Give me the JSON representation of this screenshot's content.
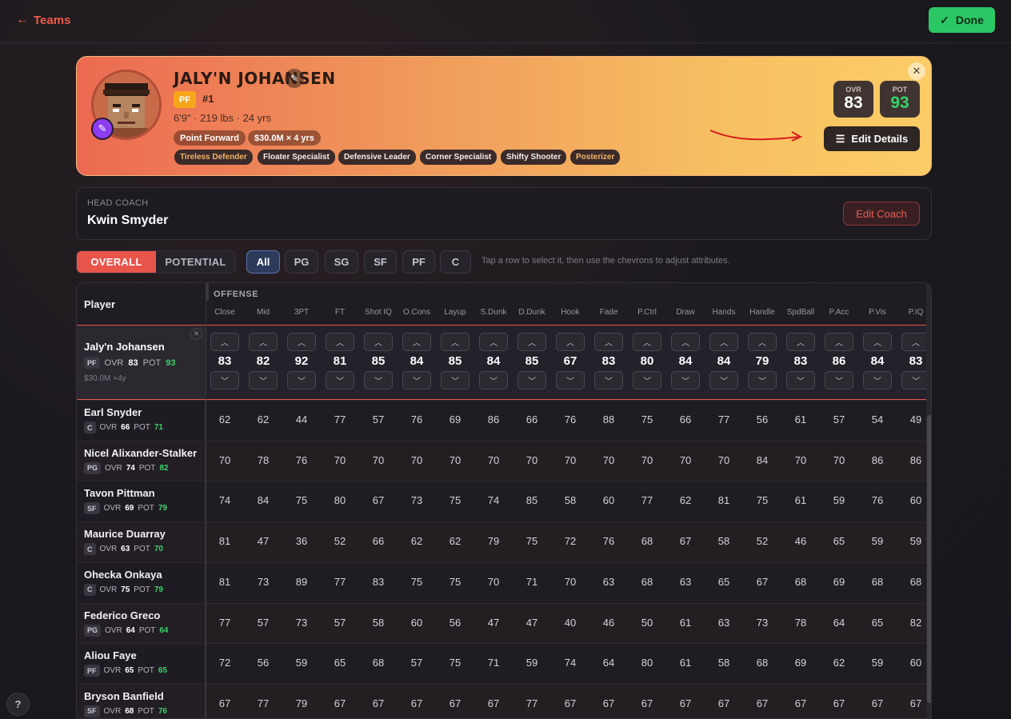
{
  "nav": {
    "back_label": "Teams",
    "done_label": "Done"
  },
  "player": {
    "name": "JALY'N JOHANSEN",
    "position": "PF",
    "jersey": "#1",
    "measurements": "6'9\" · 219 lbs · 24 yrs",
    "role": "Point Forward",
    "contract": "$30.0M × 4 yrs",
    "traits": [
      {
        "label": "Tireless Defender",
        "gold": true
      },
      {
        "label": "Floater Specialist",
        "gold": false
      },
      {
        "label": "Defensive Leader",
        "gold": false
      },
      {
        "label": "Corner Specialist",
        "gold": false
      },
      {
        "label": "Shifty Shooter",
        "gold": false
      },
      {
        "label": "Posterizer",
        "gold": true
      }
    ],
    "ovr_label": "OVR",
    "ovr": "83",
    "pot_label": "POT",
    "pot": "93",
    "edit_details_label": "Edit Details"
  },
  "coach": {
    "label": "HEAD COACH",
    "name": "Kwin Smyder",
    "edit_label": "Edit Coach"
  },
  "filters": {
    "modes": [
      "OVERALL",
      "POTENTIAL"
    ],
    "active_mode": "OVERALL",
    "positions": [
      "All",
      "PG",
      "SG",
      "SF",
      "PF",
      "C"
    ],
    "active_position": "All",
    "hint": "Tap a row to select it, then use the chevrons to adjust attributes."
  },
  "table": {
    "player_header": "Player",
    "group_label": "OFFENSE",
    "columns": [
      "Close",
      "Mid",
      "3PT",
      "FT",
      "Shot IQ",
      "O.Cons",
      "Layup",
      "S.Dunk",
      "D.Dunk",
      "Hook",
      "Fade",
      "P.Ctrl",
      "Draw",
      "Hands",
      "Handle",
      "SpdBall",
      "P.Acc",
      "P.Vis",
      "P.IQ"
    ],
    "selected": {
      "name": "Jaly'n Johansen",
      "pos": "PF",
      "ovr_label": "OVR",
      "ovr": "83",
      "pot_label": "POT",
      "pot": "93",
      "money": "$30.0M ×4y",
      "values": [
        83,
        82,
        92,
        81,
        85,
        84,
        85,
        84,
        85,
        67,
        83,
        80,
        84,
        84,
        79,
        83,
        86,
        84,
        83
      ]
    },
    "rows": [
      {
        "name": "Earl Snyder",
        "pos": "C",
        "ovr": "66",
        "pot": "71",
        "values": [
          62,
          62,
          44,
          77,
          57,
          76,
          69,
          86,
          66,
          76,
          88,
          75,
          66,
          77,
          56,
          61,
          57,
          54,
          49
        ]
      },
      {
        "name": "Nicel Alixander-Stalker",
        "pos": "PG",
        "ovr": "74",
        "pot": "82",
        "values": [
          70,
          78,
          76,
          70,
          70,
          70,
          70,
          70,
          70,
          70,
          70,
          70,
          70,
          70,
          84,
          70,
          70,
          86,
          86
        ]
      },
      {
        "name": "Tavon Pittman",
        "pos": "SF",
        "ovr": "69",
        "pot": "79",
        "values": [
          74,
          84,
          75,
          80,
          67,
          73,
          75,
          74,
          85,
          58,
          60,
          77,
          62,
          81,
          75,
          61,
          59,
          76,
          60
        ]
      },
      {
        "name": "Maurice Duarray",
        "pos": "C",
        "ovr": "63",
        "pot": "70",
        "values": [
          81,
          47,
          36,
          52,
          66,
          62,
          62,
          79,
          75,
          72,
          76,
          68,
          67,
          58,
          52,
          46,
          65,
          59,
          59
        ]
      },
      {
        "name": "Ohecka Onkaya",
        "pos": "C",
        "ovr": "75",
        "pot": "79",
        "values": [
          81,
          73,
          89,
          77,
          83,
          75,
          75,
          70,
          71,
          70,
          63,
          68,
          63,
          65,
          67,
          68,
          69,
          68,
          68
        ]
      },
      {
        "name": "Federico Greco",
        "pos": "PG",
        "ovr": "64",
        "pot": "64",
        "values": [
          77,
          57,
          73,
          57,
          58,
          60,
          56,
          47,
          47,
          40,
          46,
          50,
          61,
          63,
          73,
          78,
          64,
          65,
          82
        ]
      },
      {
        "name": "Aliou Faye",
        "pos": "PF",
        "ovr": "65",
        "pot": "65",
        "values": [
          72,
          56,
          59,
          65,
          68,
          57,
          75,
          71,
          59,
          74,
          64,
          80,
          61,
          58,
          68,
          69,
          62,
          59,
          60
        ]
      },
      {
        "name": "Bryson Banfield",
        "pos": "SF",
        "ovr": "68",
        "pot": "76",
        "values": [
          67,
          77,
          79,
          67,
          67,
          67,
          67,
          67,
          77,
          67,
          67,
          67,
          67,
          67,
          67,
          67,
          67,
          67,
          67
        ]
      }
    ],
    "ovr_label": "OVR",
    "pot_label": "POT"
  },
  "help_label": "?",
  "colors": {
    "accent": "#e8554b",
    "success": "#2cc765",
    "pot_green": "#39d36a"
  }
}
